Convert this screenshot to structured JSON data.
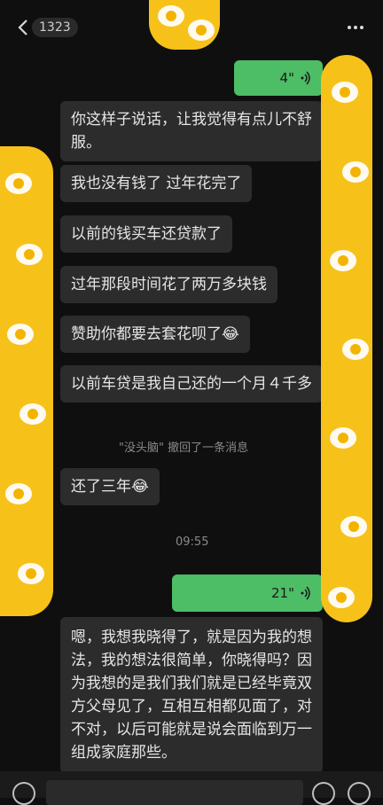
{
  "header": {
    "unread_count": "1323"
  },
  "messages": {
    "voice1": {
      "duration": "4\""
    },
    "m1": "你这样子说话，让我觉得有点儿不舒服。",
    "m2": "我也没有钱了 过年花完了",
    "m3": "以前的钱买车还贷款了",
    "m4": "过年那段时间花了两万多块钱",
    "m5": "赞助你都要去套花呗了",
    "m6": "以前车贷是我自己还的一个月４千多",
    "recall": "\"没头脑\" 撤回了一条消息",
    "m7": "还了三年",
    "time": "09:55",
    "voice2": {
      "duration": "21\""
    },
    "m8": "嗯，我想我晓得了，就是因为我的想法，我的想法很简单，你晓得吗？因为我想的是我们我们就是已经毕竟双方父母见了，互相互相都见面了，对不对，以后可能就是说会面临到万一组成家庭那些。"
  },
  "colors": {
    "voice_bubble": "#4dbd66",
    "received_bubble": "#2c2c2c",
    "sticker": "#f6c21a"
  },
  "icons": [
    "back-icon",
    "more-icon",
    "voice-wave-icon",
    "crying-laugh-emoji-icon",
    "voice-input-icon",
    "emoji-icon",
    "plus-icon"
  ]
}
